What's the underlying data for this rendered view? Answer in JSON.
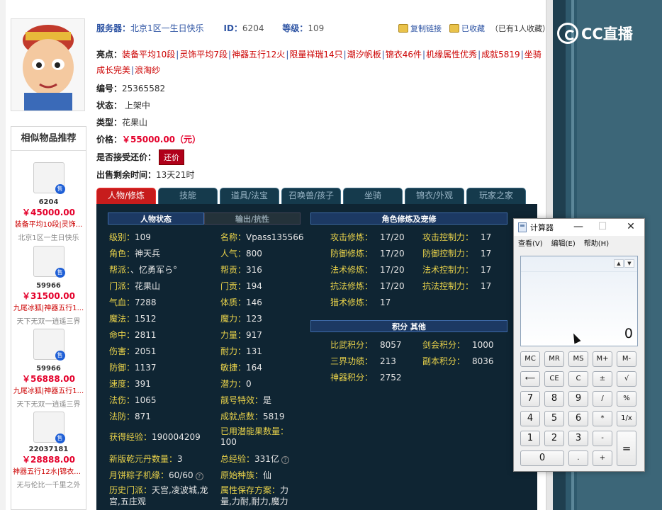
{
  "header": {
    "server_label": "服务器：",
    "server_value": "北京1区一生日快乐",
    "id_label": "ID：",
    "id_value": "6204",
    "level_label": "等级：",
    "level_value": "109",
    "copy_link": "复制链接",
    "favorite": "已收藏",
    "favorite_count": "（已有1人收藏）"
  },
  "highlights": {
    "label": "亮点：",
    "tags": [
      "装备平均10段",
      "灵饰平均7段",
      "神器五行12火",
      "限量祥瑞14只",
      "潮汐帆板",
      "锦衣46件",
      "机缘属性优秀",
      "成就5819",
      "坐骑成长完美",
      "浪淘纱"
    ]
  },
  "info": {
    "number_label": "编号：",
    "number_value": "25365582",
    "status_label": "状态：",
    "status_value": "上架中",
    "type_label": "类型：",
    "type_value": "花果山",
    "price_label": "价格：",
    "price_value": "￥55000.00（元）",
    "bargain_label": "是否接受还价：",
    "bargain_button": "还价",
    "remaining_label": "出售剩余时间：",
    "remaining_value": "13天21时"
  },
  "sidebar": {
    "title": "相似物品推荐",
    "items": [
      {
        "id": "6204",
        "price": "￥45000.00",
        "tag": "装备平均10段|灵饰...",
        "server": "北京1区一生日快乐"
      },
      {
        "id": "59966",
        "price": "￥31500.00",
        "tag": "九尾冰狐|神器五行1...",
        "server": "天下无双一逍遥三界"
      },
      {
        "id": "59966",
        "price": "￥56888.00",
        "tag": "九尾冰狐|神器五行1...",
        "server": "天下无双一逍遥三界"
      },
      {
        "id": "22037181",
        "price": "￥28888.00",
        "tag": "神器五行12水|锦衣4...",
        "server": "无与伦比一千里之外"
      }
    ],
    "sale_badge": "售"
  },
  "tabs": [
    "人物/修炼",
    "技能",
    "道具/法宝",
    "召唤兽/孩子",
    "坐骑",
    "锦衣/外观",
    "玩家之家"
  ],
  "panel": {
    "left_tab_active": "人物状态",
    "left_tab_inactive": "输出/抗性",
    "col1": [
      {
        "k": "级别：",
        "v": "109"
      },
      {
        "k": "角色：",
        "v": "神天兵"
      },
      {
        "k": "帮派：",
        "v": "、忆勇军ら°"
      },
      {
        "k": "门派：",
        "v": "花果山"
      },
      {
        "k": "气血：",
        "v": "7288"
      },
      {
        "k": "魔法：",
        "v": "1512"
      },
      {
        "k": "命中：",
        "v": "2811"
      },
      {
        "k": "伤害：",
        "v": "2051"
      },
      {
        "k": "防御：",
        "v": "1137"
      },
      {
        "k": "速度：",
        "v": "391"
      },
      {
        "k": "法伤：",
        "v": "1065"
      },
      {
        "k": "法防：",
        "v": "871"
      }
    ],
    "col2": [
      {
        "k": "名称：",
        "v": "Vpass135566"
      },
      {
        "k": "人气：",
        "v": "800"
      },
      {
        "k": "帮贡：",
        "v": "316"
      },
      {
        "k": "门贡：",
        "v": "194"
      },
      {
        "k": "体质：",
        "v": "146"
      },
      {
        "k": "魔力：",
        "v": "123"
      },
      {
        "k": "力量：",
        "v": "917"
      },
      {
        "k": "耐力：",
        "v": "131"
      },
      {
        "k": "敏捷：",
        "v": "164"
      },
      {
        "k": "潜力：",
        "v": "0"
      },
      {
        "k": "靓号特效：",
        "v": "是"
      },
      {
        "k": "成就点数：",
        "v": "5819"
      }
    ],
    "extra": {
      "exp_k": "获得经验：",
      "exp_v": "190004209",
      "used_k": "已用潜能果数量：",
      "used_v": "100",
      "dan_k": "新版乾元丹数量：",
      "dan_v": "3",
      "total_k": "总经验：",
      "total_v": "331亿",
      "zongzi_k": "月饼粽子机缘：",
      "zongzi_v": "60/60",
      "race_k": "原始种族：",
      "race_v": "仙",
      "hist_k": "历史门派：",
      "hist_v": "天宫,凌波城,龙宫,五庄观",
      "save_k": "属性保存方案：",
      "save_v": "力量,力耐,耐力,魔力"
    },
    "cultivation_title": "角色修炼及宠修",
    "cultivation": [
      {
        "k": "攻击修炼：",
        "v": "17/20",
        "k2": "攻击控制力：",
        "v2": "17"
      },
      {
        "k": "防御修炼：",
        "v": "17/20",
        "k2": "防御控制力：",
        "v2": "17"
      },
      {
        "k": "法术修炼：",
        "v": "17/20",
        "k2": "法术控制力：",
        "v2": "17"
      },
      {
        "k": "抗法修炼：",
        "v": "17/20",
        "k2": "抗法控制力：",
        "v2": "17"
      },
      {
        "k": "猎术修炼：",
        "v": "17",
        "k2": "",
        "v2": ""
      }
    ],
    "score_title": "积分 其他",
    "scores": [
      {
        "k": "比武积分：",
        "v": "8057",
        "k2": "剑会积分：",
        "v2": "1000"
      },
      {
        "k": "三界功绩：",
        "v": "213",
        "k2": "副本积分：",
        "v2": "8036"
      },
      {
        "k": "神器积分：",
        "v": "2752",
        "k2": "",
        "v2": ""
      }
    ]
  },
  "calculator": {
    "title": "计算器",
    "menu": [
      "查看(V)",
      "编辑(E)",
      "帮助(H)"
    ],
    "display": "0",
    "keys": {
      "mc": "MC",
      "mr": "MR",
      "ms": "MS",
      "mplus": "M+",
      "mminus": "M-",
      "back": "⟵",
      "ce": "CE",
      "c": "C",
      "pm": "±",
      "sqrt": "√",
      "k7": "7",
      "k8": "8",
      "k9": "9",
      "div": "/",
      "pct": "%",
      "k4": "4",
      "k5": "5",
      "k6": "6",
      "mul": "*",
      "inv": "1/x",
      "k1": "1",
      "k2": "2",
      "k3": "3",
      "sub": "-",
      "eq": "=",
      "k0": "0",
      "dot": ".",
      "add": "+"
    }
  },
  "logo": "CC直播"
}
